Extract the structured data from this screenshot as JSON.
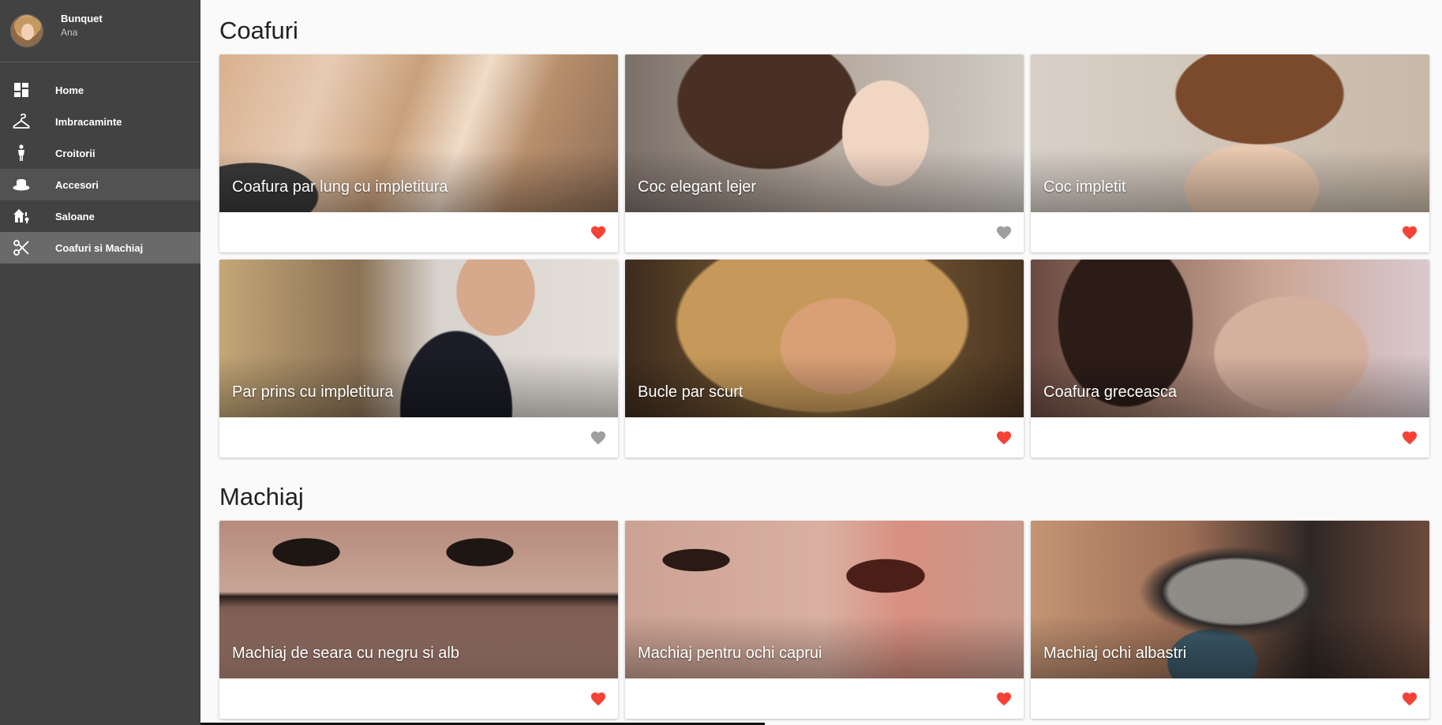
{
  "profile": {
    "name": "Bunquet",
    "subtitle": "Ana"
  },
  "nav": {
    "items": [
      {
        "label": "Home",
        "icon": "dashboard-icon"
      },
      {
        "label": "Imbracaminte",
        "icon": "hanger-icon"
      },
      {
        "label": "Croitorii",
        "icon": "mannequin-icon"
      },
      {
        "label": "Accesori",
        "icon": "hat-icon"
      },
      {
        "label": "Saloane",
        "icon": "house-icon"
      },
      {
        "label": "Coafuri si Machiaj",
        "icon": "scissors-icon"
      }
    ],
    "active": "Coafuri si Machiaj",
    "hovered": "Accesori"
  },
  "sections": [
    {
      "title": "Coafuri",
      "cards": [
        {
          "title": "Coafura par lung cu impletitura",
          "favorite": true
        },
        {
          "title": "Coc elegant lejer",
          "favorite": false
        },
        {
          "title": "Coc impletit",
          "favorite": true
        },
        {
          "title": "Par prins cu impletitura",
          "favorite": false
        },
        {
          "title": "Bucle par scurt",
          "favorite": true
        },
        {
          "title": "Coafura greceasca",
          "favorite": true
        }
      ]
    },
    {
      "title": "Machiaj",
      "cards": [
        {
          "title": "Machiaj de seara cu negru si alb",
          "favorite": true
        },
        {
          "title": "Machiaj pentru ochi caprui",
          "favorite": true
        },
        {
          "title": "Machiaj ochi albastri",
          "favorite": true
        }
      ]
    }
  ],
  "colors": {
    "sidebar": "#424242",
    "favorite_on": "#f44336",
    "favorite_off": "#9e9e9e"
  }
}
